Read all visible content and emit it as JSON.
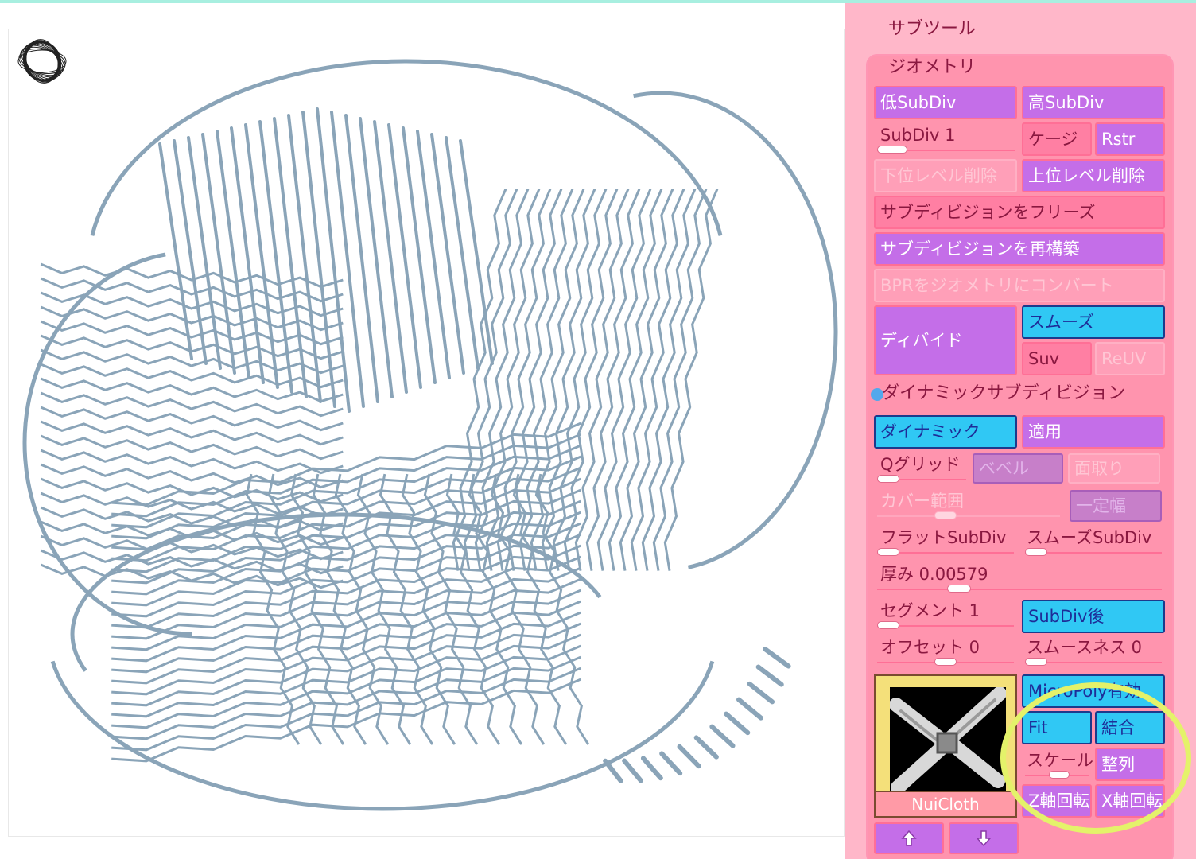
{
  "panel": {
    "title": "サブツール",
    "geometry_header": "ジオメトリ",
    "lower_subdiv": "低SubDiv",
    "higher_subdiv": "高SubDiv",
    "subdiv_label": "SubDiv 1",
    "cage": "ケージ",
    "rstr": "Rstr",
    "del_lower": "下位レベル削除",
    "del_higher": "上位レベル削除",
    "freeze_subdiv": "サブディビジョンをフリーズ",
    "reconstruct_subdiv": "サブディビジョンを再構築",
    "convert_bpr": "BPRをジオメトリにコンバート",
    "divide": "ディバイド",
    "smooth": "スムーズ",
    "suv": "Suv",
    "reuv": "ReUV",
    "dynamic_header": "ダイナミックサブディビジョン",
    "dynamic": "ダイナミック",
    "apply": "適用",
    "qgrid": "Qグリッド",
    "bevel": "ベベル",
    "chamfer": "面取り",
    "coverage": "カバー範囲",
    "constant": "一定幅",
    "flat_subdiv": "フラットSubDiv",
    "smooth_subdiv": "スムーズSubDiv",
    "thickness": "厚み 0.00579",
    "segments": "セグメント 1",
    "after_subdiv": "SubDiv後",
    "offset": "オフセット 0",
    "smoothness": "スムースネス 0",
    "micropoly": "MicroPoly有効",
    "fit": "Fit",
    "merge": "結合",
    "scale": "スケール",
    "align": "整列",
    "z_rotate": "Z軸回転",
    "x_rotate": "X軸回転",
    "thumbnail_label": "NuiCloth"
  },
  "colors": {
    "panel_bg": "#ffb7c9",
    "button_purple": "#c46ee8",
    "button_cyan": "#30c8f4",
    "mesh": "#8aa4b8",
    "highlight_circle": "#e4f26a"
  }
}
